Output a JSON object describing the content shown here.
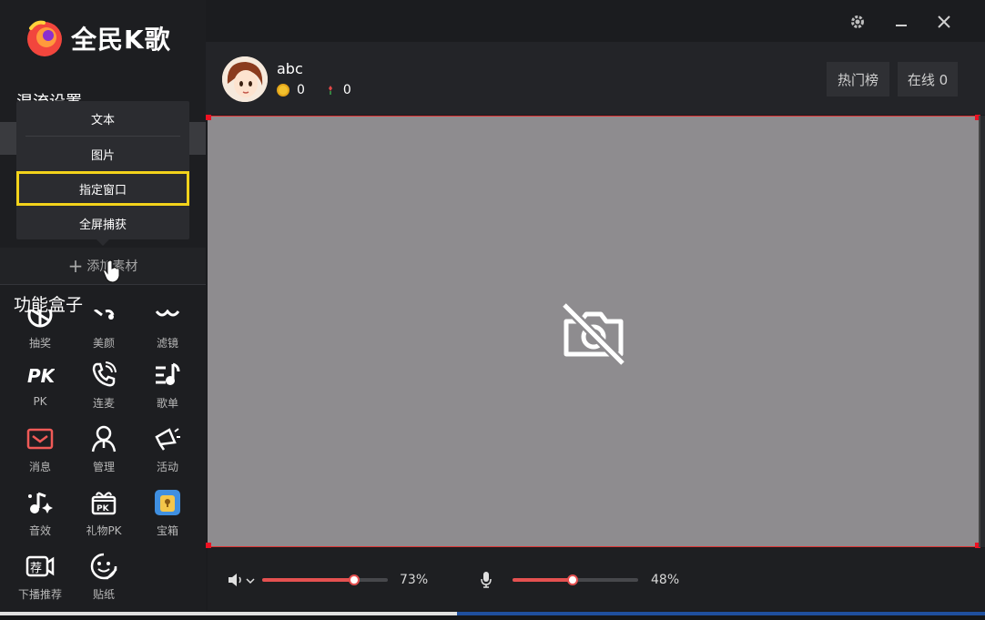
{
  "app": {
    "name": "全民K歌"
  },
  "sidebar": {
    "section_title": "混流设置",
    "dropdown": {
      "items": [
        "文本",
        "图片",
        "指定窗口",
        "全屏捕获"
      ],
      "highlighted_index": 2
    },
    "add_material_label": "添加素材",
    "function_box_title": "功能盒子",
    "functions": [
      {
        "label": "抽奖",
        "icon": "lottery-icon"
      },
      {
        "label": "美颜",
        "icon": "beauty-icon"
      },
      {
        "label": "滤镜",
        "icon": "filter-icon"
      },
      {
        "label": "PK",
        "icon": "pk-icon"
      },
      {
        "label": "连麦",
        "icon": "phone-icon"
      },
      {
        "label": "歌单",
        "icon": "playlist-icon"
      },
      {
        "label": "消息",
        "icon": "message-icon"
      },
      {
        "label": "管理",
        "icon": "manage-icon"
      },
      {
        "label": "活动",
        "icon": "megaphone-icon"
      },
      {
        "label": "音效",
        "icon": "sound-effect-icon"
      },
      {
        "label": "礼物PK",
        "icon": "gift-pk-icon"
      },
      {
        "label": "宝箱",
        "icon": "treasure-box-icon"
      },
      {
        "label": "下播推荐",
        "icon": "recommend-icon"
      },
      {
        "label": "贴纸",
        "icon": "sticker-icon"
      }
    ]
  },
  "user": {
    "name": "abc",
    "coins": "0",
    "flowers": "0"
  },
  "header_tabs": {
    "hot_rank": "热门榜",
    "online": "在线 0"
  },
  "controls": {
    "volume": 0.73,
    "volume_label": "73%",
    "mic": 0.48,
    "mic_label": "48%"
  },
  "colors": {
    "accent": "#e55151",
    "highlight": "#f3d31b",
    "preview_bg": "#8e8c8f"
  }
}
